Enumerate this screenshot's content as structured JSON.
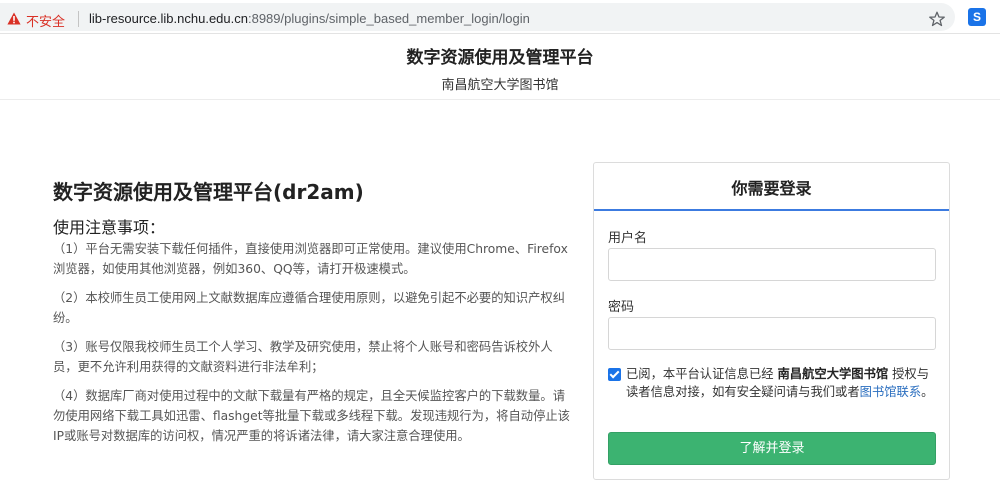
{
  "browser": {
    "insecure_label": "不安全",
    "url_host": "lib-resource.lib.nchu.edu.cn",
    "url_rest": ":8989/plugins/simple_based_member_login/login",
    "ext_label": "S"
  },
  "header": {
    "title": "数字资源使用及管理平台",
    "subtitle": "南昌航空大学图书馆"
  },
  "notes": {
    "title": "数字资源使用及管理平台(dr2am)",
    "heading": "使用注意事项：",
    "items": [
      "（1）平台无需安装下载任何插件，直接使用浏览器即可正常使用。建议使用Chrome、Firefox浏览器，如使用其他浏览器，例如360、QQ等，请打开极速模式。",
      "（2）本校师生员工使用网上文献数据库应遵循合理使用原则，以避免引起不必要的知识产权纠纷。",
      "（3）账号仅限我校师生员工个人学习、教学及研究使用，禁止将个人账号和密码告诉校外人员，更不允许利用获得的文献资料进行非法牟利；",
      "（4）数据库厂商对使用过程中的文献下载量有严格的规定，且全天候监控客户的下载数量。请勿使用网络下载工具如迅雷、flashget等批量下载或多线程下载。发现违规行为，将自动停止该IP或账号对数据库的访问权，情况严重的将诉诸法律，请大家注意合理使用。"
    ]
  },
  "login": {
    "title": "你需要登录",
    "username_label": "用户名",
    "username_value": "",
    "password_label": "密码",
    "password_value": "",
    "agree_checked": true,
    "agree_prefix": "已阅，本平台认证信息已经",
    "agree_org": "南昌航空大学图书馆",
    "agree_middle": "授权与读者信息对接，如有安全疑问请与我们或者",
    "agree_link": "图书馆联系",
    "agree_suffix": "。",
    "submit_label": "了解并登录"
  },
  "colors": {
    "accent": "#3c7be0",
    "button": "#3cb371",
    "link": "#2a6ebf",
    "warning": "#d93025"
  }
}
